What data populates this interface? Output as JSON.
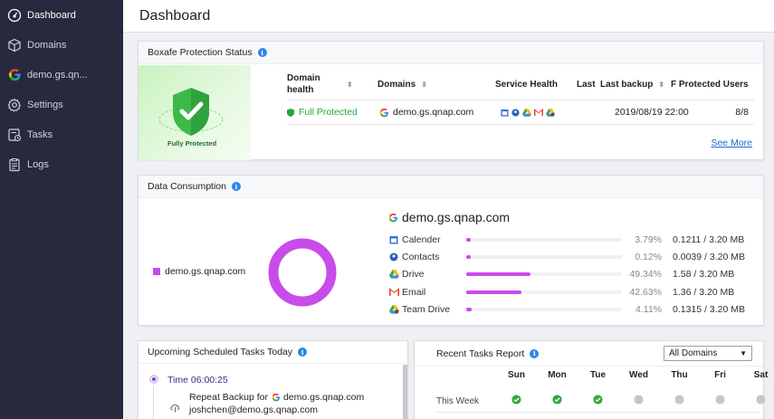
{
  "sidebar": {
    "items": [
      {
        "label": "Dashboard",
        "icon": "dashboard-icon"
      },
      {
        "label": "Domains",
        "icon": "cube-icon"
      },
      {
        "label": "demo.gs.qn...",
        "icon": "google-icon"
      },
      {
        "label": "Settings",
        "icon": "gear-icon"
      },
      {
        "label": "Tasks",
        "icon": "tasks-icon"
      },
      {
        "label": "Logs",
        "icon": "logs-icon"
      }
    ]
  },
  "header": {
    "title": "Dashboard"
  },
  "protection": {
    "title": "Boxafe Protection Status",
    "shield_label": "Fully Protected",
    "columns": [
      "Domain health",
      "Domains",
      "Service Health",
      "Last",
      "Last backup",
      "F",
      "Protected Users"
    ],
    "row": {
      "health": "Full Protected",
      "domain": "demo.gs.qnap.com",
      "last_backup": "2019/08/19 22:00",
      "users": "8/8"
    },
    "see_more": "See More"
  },
  "data_consumption": {
    "title": "Data Consumption",
    "legend_label": "demo.gs.qnap.com",
    "domain": "demo.gs.qnap.com",
    "accent": "#c84bea",
    "services": [
      {
        "name": "Calender",
        "icon": "calendar-icon",
        "pct": "3.79%",
        "size": "0.1211 / 3.20 MB",
        "fraction": 0.0379
      },
      {
        "name": "Contacts",
        "icon": "contacts-icon",
        "pct": "0.12%",
        "size": "0.0039 / 3.20 MB",
        "fraction": 0.0012
      },
      {
        "name": "Drive",
        "icon": "drive-icon",
        "pct": "49.34%",
        "size": "1.58 / 3.20 MB",
        "fraction": 0.4934
      },
      {
        "name": "Email",
        "icon": "gmail-icon",
        "pct": "42.63%",
        "size": "1.36 / 3.20 MB",
        "fraction": 0.4263
      },
      {
        "name": "Team Drive",
        "icon": "team-drive-icon",
        "pct": "4.11%",
        "size": "0.1315 / 3.20 MB",
        "fraction": 0.0411
      }
    ]
  },
  "upcoming": {
    "title": "Upcoming Scheduled Tasks Today",
    "time": "Time 06:00:25",
    "task": "Repeat Backup for",
    "domain": "demo.gs.qnap.com",
    "user": "joshchen@demo.gs.qnap.com"
  },
  "recent": {
    "title": "Recent Tasks Report",
    "filter": "All Domains",
    "days": [
      "Sun",
      "Mon",
      "Tue",
      "Wed",
      "Thu",
      "Fri",
      "Sat"
    ],
    "week_label": "This Week",
    "statuses": [
      "success",
      "success",
      "success",
      "none",
      "none",
      "none",
      "none"
    ]
  }
}
